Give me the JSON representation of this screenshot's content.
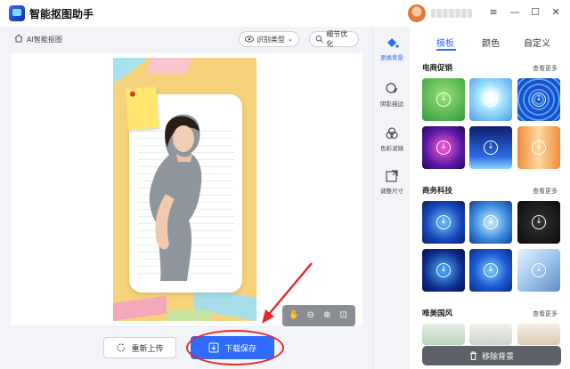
{
  "app": {
    "title": "智能抠图助手"
  },
  "window": {
    "menu_icon": "≡",
    "minimize_icon": "—",
    "maximize_icon": "☐",
    "close_icon": "✕"
  },
  "breadcrumb": {
    "label": "AI智能抠图"
  },
  "toolbar": {
    "recognize_type": "识别类型",
    "detail_optimize": "细节优化"
  },
  "actions": {
    "reupload": "重新上传",
    "download": "下载保存"
  },
  "tool_nav": [
    {
      "label": "更换背景",
      "icon": "paint-bucket-icon",
      "active": true
    },
    {
      "label": "阴影描边",
      "icon": "shadow-icon",
      "active": false
    },
    {
      "label": "色彩滤镜",
      "icon": "color-filter-icon",
      "active": false
    },
    {
      "label": "调整尺寸",
      "icon": "resize-icon",
      "active": false
    }
  ],
  "panel": {
    "tabs": [
      "模板",
      "颜色",
      "自定义"
    ],
    "active_tab": "模板",
    "sections": [
      {
        "title": "电商促销",
        "see_more": "查看更多"
      },
      {
        "title": "商务科技",
        "see_more": "查看更多"
      },
      {
        "title": "唯美国风",
        "see_more": "查看更多"
      }
    ],
    "remove_bg": "移除背景"
  },
  "colors": {
    "accent": "#2f6bff",
    "annotation_red": "#e12b2b"
  }
}
